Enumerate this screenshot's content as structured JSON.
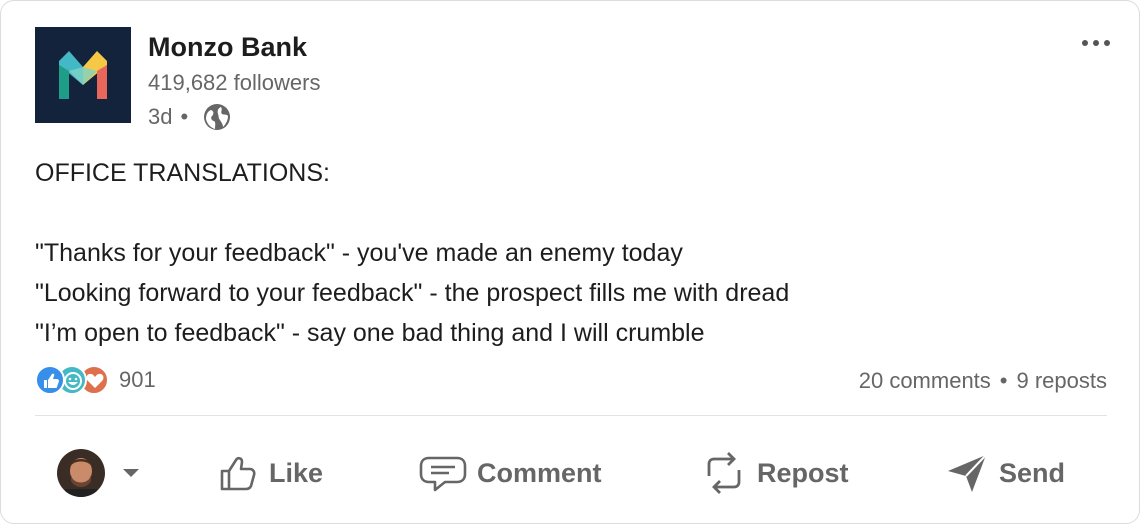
{
  "post": {
    "author": "Monzo Bank",
    "followers": "419,682 followers",
    "age": "3d",
    "age_separator": "•",
    "text": "OFFICE TRANSLATIONS:\n\n\"Thanks for your feedback\" - you've made an enemy today\n\"Looking forward to your feedback\" - the prospect fills me with dread\n\"I’m open to feedback\" - say one bad thing and I will crumble"
  },
  "engagement": {
    "reactions_count": "901",
    "comments": "20 comments",
    "separator": "•",
    "reposts": "9 reposts"
  },
  "actions": {
    "like": "Like",
    "comment": "Comment",
    "repost": "Repost",
    "send": "Send"
  },
  "icons": [
    "monzo-logo",
    "globe-icon",
    "more-icon",
    "like-reaction-icon",
    "celebrate-reaction-icon",
    "love-reaction-icon",
    "avatar",
    "chevron-down-icon",
    "like-icon",
    "comment-icon",
    "repost-icon",
    "send-icon"
  ],
  "colors": {
    "logo_bg": "#14233c",
    "like_reaction": "#378fe9",
    "celebrate_reaction": "#44b8c4",
    "love_reaction": "#df704d",
    "muted_text": "#666666"
  }
}
